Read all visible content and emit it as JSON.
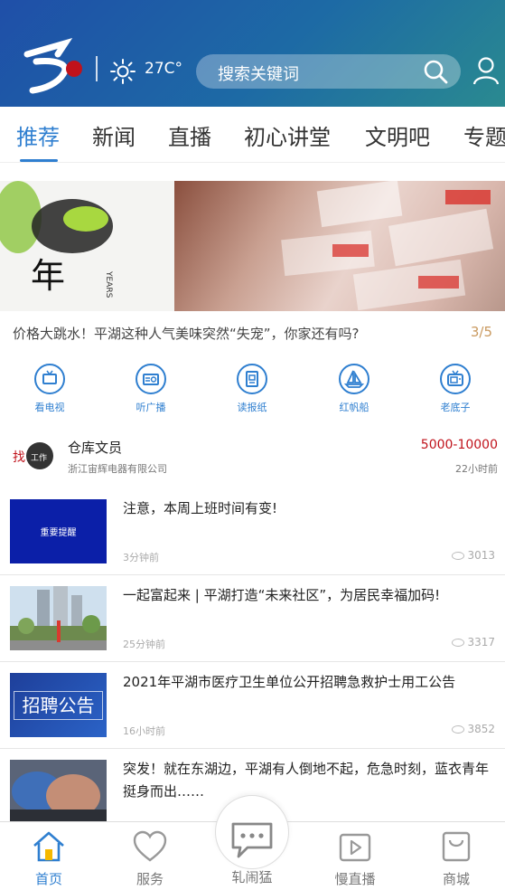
{
  "header": {
    "temperature": "27C°",
    "search_placeholder": "搜索关键词"
  },
  "tabs": [
    {
      "label": "推荐",
      "active": true
    },
    {
      "label": "新闻"
    },
    {
      "label": "直播"
    },
    {
      "label": "初心讲堂"
    },
    {
      "label": "文明吧"
    },
    {
      "label": "专题"
    }
  ],
  "banner": {
    "caption": "价格大跳水！平湖这种人气美味突然“失宠”，你家还有吗?",
    "counter": "3/5",
    "left_text": "年",
    "left_subtext": "YEARS"
  },
  "quick_links": [
    {
      "label": "看电视",
      "icon": "tv-icon"
    },
    {
      "label": "听广播",
      "icon": "radio-icon"
    },
    {
      "label": "读报纸",
      "icon": "newspaper-icon"
    },
    {
      "label": "红帆船",
      "icon": "sailboat-icon"
    },
    {
      "label": "老底子",
      "icon": "retro-tv-icon"
    }
  ],
  "job": {
    "logo_text_1": "找",
    "logo_text_2": "工作",
    "title": "仓库文员",
    "company": "浙江宙辉电器有限公司",
    "salary": "5000-10000",
    "time": "22小时前"
  },
  "news": [
    {
      "title": "注意，本周上班时间有变!",
      "time": "3分钟前",
      "views": "3013",
      "thumb_text": "重要提醒"
    },
    {
      "title": "一起富起来 | 平湖打造“未来社区”，为居民幸福加码!",
      "time": "25分钟前",
      "views": "3317",
      "thumb_text": ""
    },
    {
      "title": "2021年平湖市医疗卫生单位公开招聘急救护士用工公告",
      "time": "16小时前",
      "views": "3852",
      "thumb_text": "招聘公告"
    },
    {
      "title": "突发！就在东湖边，平湖有人倒地不起，危急时刻，蓝衣青年挺身而出……",
      "time": "",
      "views": "",
      "thumb_text": ""
    }
  ],
  "bottom_nav": [
    {
      "label": "首页",
      "icon": "home-icon",
      "active": true
    },
    {
      "label": "服务",
      "icon": "heart-icon"
    },
    {
      "label": "轧闹猛",
      "icon": "chat-icon"
    },
    {
      "label": "慢直播",
      "icon": "video-icon"
    },
    {
      "label": "商城",
      "icon": "shopping-bag-icon"
    }
  ]
}
